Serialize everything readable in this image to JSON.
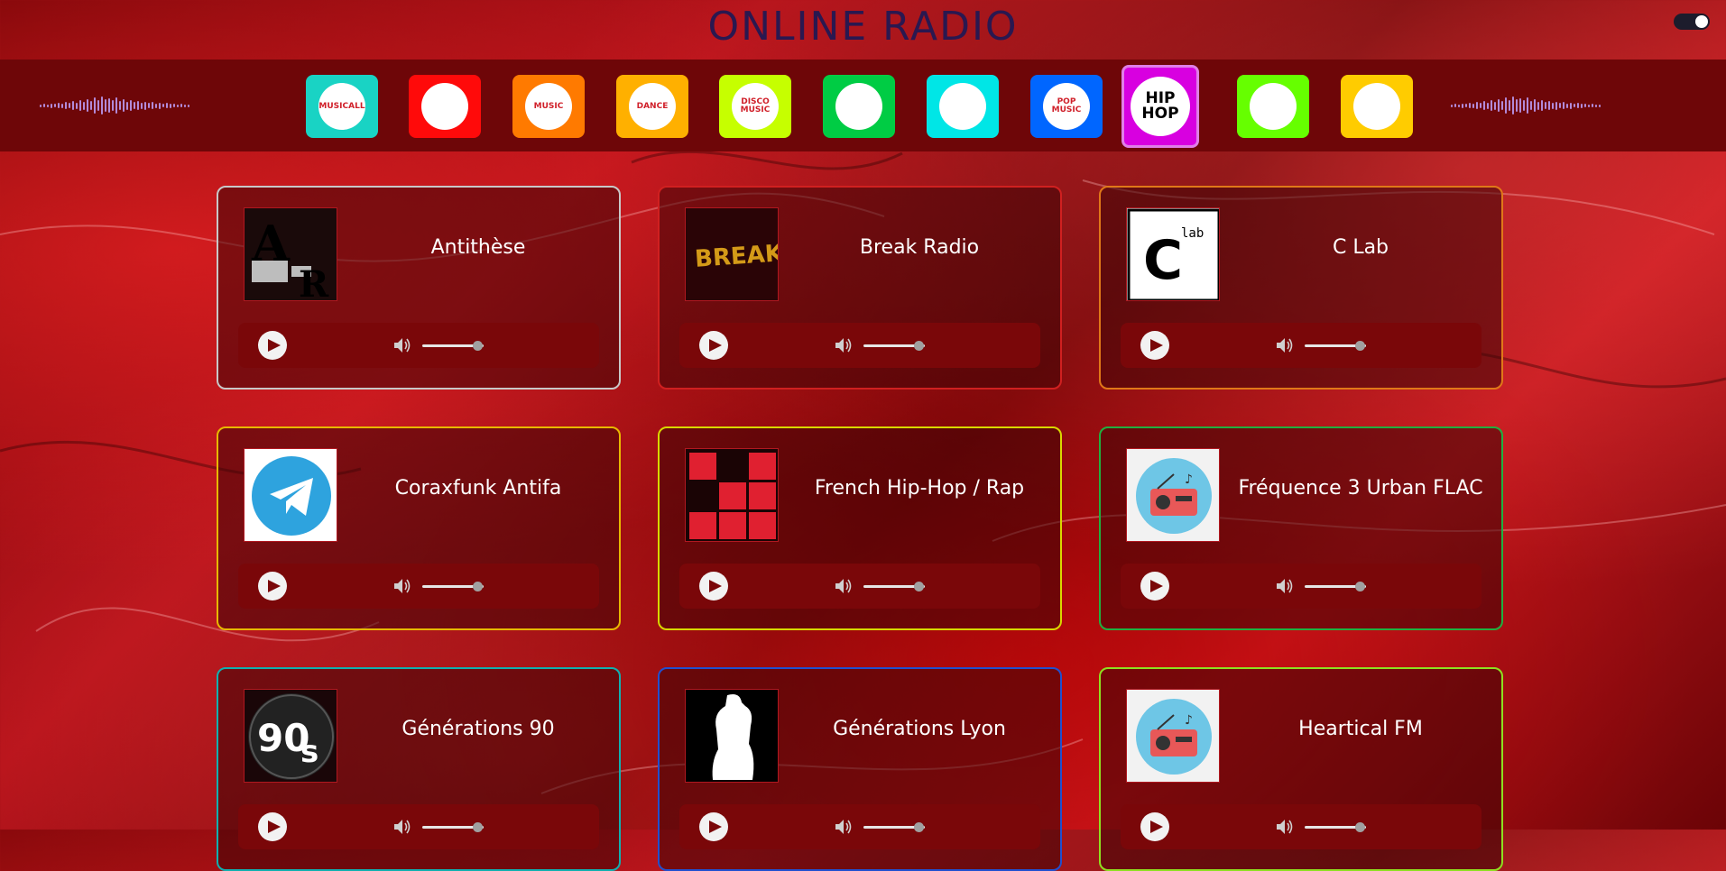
{
  "app": {
    "title": "ONLINE RADIO"
  },
  "theme_toggle": {
    "state": "on"
  },
  "genres": [
    {
      "name": "musicall",
      "label": "MUSICALL",
      "tile_color": "#19d3c4",
      "active": false
    },
    {
      "name": "rock",
      "label": "",
      "tile_color": "#ff0a0a",
      "active": false
    },
    {
      "name": "music",
      "label": "MUSIC",
      "tile_color": "#ff7a00",
      "active": false
    },
    {
      "name": "dance",
      "label": "DANCE",
      "tile_color": "#ffb000",
      "active": false
    },
    {
      "name": "disco",
      "label": "DISCO MUSIC",
      "tile_color": "#c6ff00",
      "active": false
    },
    {
      "name": "electro",
      "label": "",
      "tile_color": "#00cc44",
      "active": false
    },
    {
      "name": "chill",
      "label": "",
      "tile_color": "#00e6e6",
      "active": false
    },
    {
      "name": "pop",
      "label": "POP MUSIC",
      "tile_color": "#0066ff",
      "active": false
    },
    {
      "name": "hiphop",
      "label": "HIP HOP",
      "tile_color": "#d800e0",
      "active": true
    },
    {
      "name": "retro",
      "label": "",
      "tile_color": "#66ff00",
      "active": false
    },
    {
      "name": "podcast",
      "label": "",
      "tile_color": "#ffcc00",
      "active": false
    }
  ],
  "stations": [
    {
      "name": "Antithèse",
      "border_color": "#c8c8c8",
      "logo": "ar-logo",
      "volume": 0.85
    },
    {
      "name": "Break Radio",
      "border_color": "#d02020",
      "logo": "break-logo",
      "volume": 0.85
    },
    {
      "name": "C Lab",
      "border_color": "#e07818",
      "logo": "clab-logo",
      "volume": 0.85
    },
    {
      "name": "Coraxfunk Antifa",
      "border_color": "#e8b800",
      "logo": "telegram-logo",
      "volume": 0.85
    },
    {
      "name": "French Hip-Hop / Rap",
      "border_color": "#d8d800",
      "logo": "red-squares-logo",
      "volume": 0.85
    },
    {
      "name": "Fréquence 3 Urban FLAC",
      "border_color": "#20b040",
      "logo": "radio-logo",
      "volume": 0.85
    },
    {
      "name": "Générations 90",
      "border_color": "#10b0b0",
      "logo": "90s-logo",
      "volume": 0.85
    },
    {
      "name": "Générations Lyon",
      "border_color": "#2050d0",
      "logo": "silhouette-logo",
      "volume": 0.85
    },
    {
      "name": "Heartical FM",
      "border_color": "#8ee020",
      "logo": "radio-logo",
      "volume": 0.85
    }
  ]
}
